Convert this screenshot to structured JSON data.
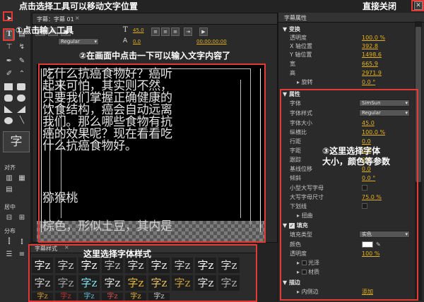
{
  "tools": {
    "align_label": "对齐",
    "center_label": "居中",
    "distribute_label": "分布"
  },
  "title_panel": {
    "tab_label": "字幕：字幕 01",
    "font_dropdown": "Regular",
    "size_value": "45.0",
    "leading_value": "0.0",
    "timecode": "00:00:00:00"
  },
  "canvas": {
    "lines": [
      "吃什么抗癌食物好？癌听",
      "起来可怕，其实则不然，",
      "只要我们掌握正确健康的",
      "饮食结构，癌会自动远离",
      "我们。那么哪些食物有抗",
      "癌的效果呢？现在看看吃",
      "什么抗癌食物好。"
    ],
    "heading": "猕猴桃",
    "bottom_line": "棕色，形似土豆，其内是"
  },
  "styles_panel": {
    "tab_label": "字幕样式",
    "swatch_text": "字z"
  },
  "properties": {
    "tab_label": "字幕属性",
    "transform_title": "变换",
    "transform": [
      {
        "label": "透明度",
        "value": "100.0 %"
      },
      {
        "label": "X 轴位置",
        "value": "392.8"
      },
      {
        "label": "Y 轴位置",
        "value": "1498.6"
      },
      {
        "label": "宽",
        "value": "665.9"
      },
      {
        "label": "高",
        "value": "2971.9"
      },
      {
        "label": "旋转",
        "value": "0.0 °"
      }
    ],
    "attr_title": "属性",
    "font_label": "字体",
    "font_value": "SimSun",
    "style_label": "字体样式",
    "style_value": "Regular",
    "attrs": [
      {
        "label": "字体大小",
        "value": "45.0"
      },
      {
        "label": "纵横比",
        "value": "100.0 %"
      },
      {
        "label": "行距",
        "value": "0.0"
      },
      {
        "label": "字距",
        "value": "0.0"
      },
      {
        "label": "跟踪",
        "value": "0.0"
      },
      {
        "label": "基线位移",
        "value": "0.0"
      },
      {
        "label": "倾斜",
        "value": "0.0 °"
      }
    ],
    "smallcaps_label": "小型大写字母",
    "smallcaps_size_label": "大写字母尺寸",
    "smallcaps_size_value": "75.0 %",
    "underline_label": "下划线",
    "distort_label": "扭曲",
    "fill_title": "填充",
    "fill_type_label": "填充类型",
    "fill_type_value": "实色",
    "color_label": "颜色",
    "fill_opacity_label": "透明度",
    "fill_opacity_value": "100 %",
    "sheen_label": "光泽",
    "texture_label": "材质",
    "stroke_title": "描边",
    "inner_stroke_label": "内侧边",
    "inner_stroke_action": "添加"
  },
  "annotations": {
    "select_tool": "点击选择工具可以移动文字位置",
    "close_direct": "直接关闭",
    "click_text_tool": "①点击输入工具",
    "click_canvas": "②在画面中点击一下可以输入文字内容了",
    "choose_font": "③这里选择字体",
    "choose_font_2": "大小，颜色等参数",
    "choose_style": "这里选择字体样式"
  },
  "colors": {
    "annotation_red": "#e53935",
    "value_yellow": "#e5b21e",
    "panel_bg": "#2a2a2a"
  }
}
